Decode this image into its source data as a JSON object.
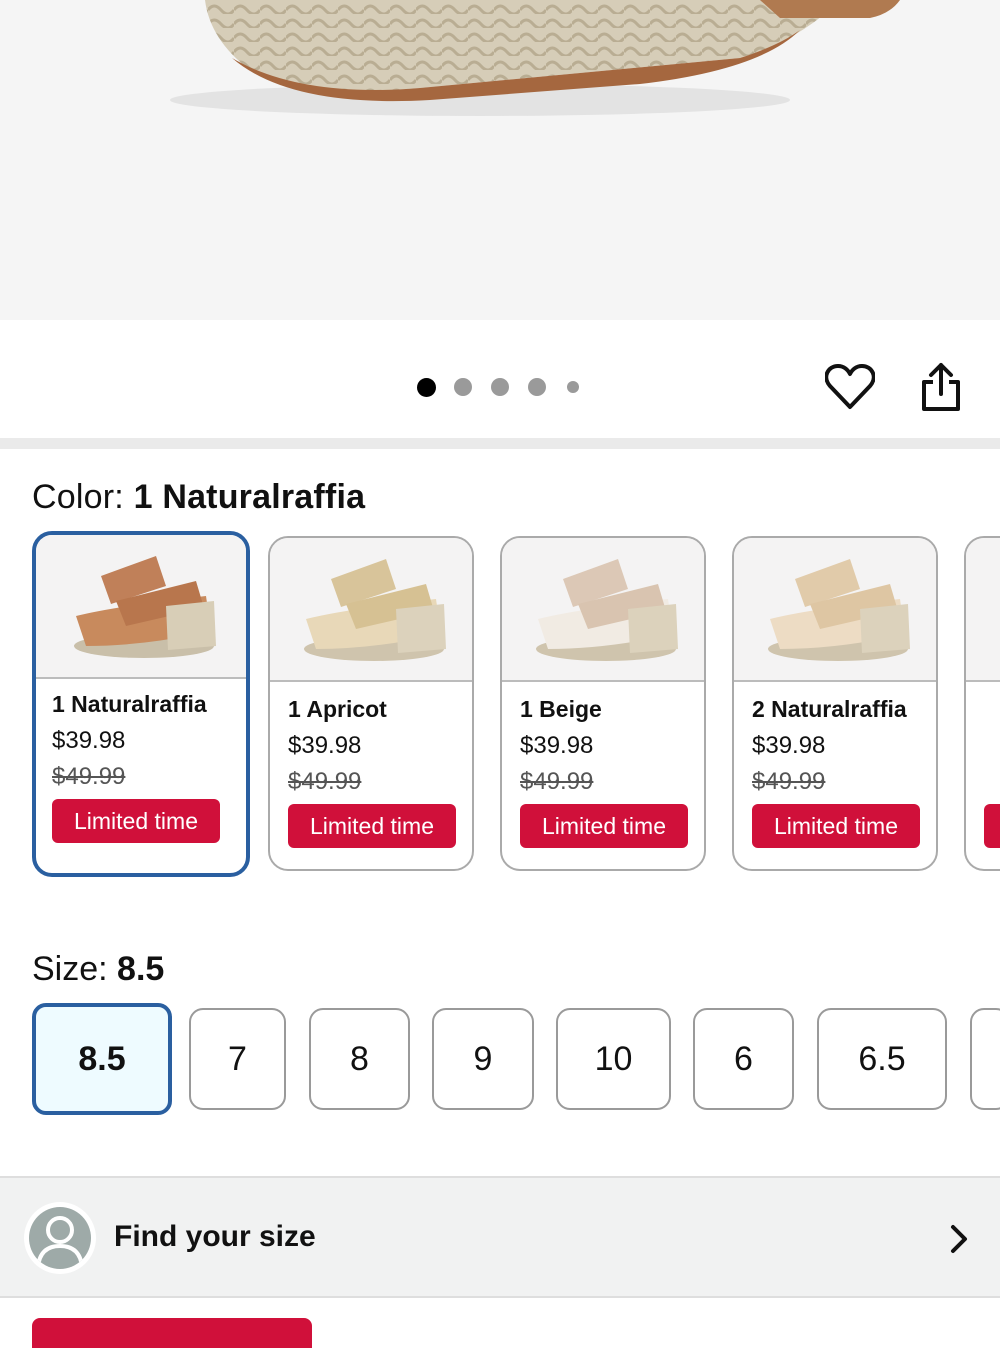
{
  "colors": {
    "accent_red": "#d0103a",
    "selected_blue": "#2a5fa0"
  },
  "carousel": {
    "dot_count": 5,
    "active_index": 0
  },
  "actions": {
    "favorite_icon": "heart-icon",
    "share_icon": "share-icon"
  },
  "color_section": {
    "prefix": "Color:",
    "selected": "1 Naturalraffia",
    "options": [
      {
        "name": "1 Naturalraffia",
        "price": "$39.98",
        "was": "$49.99",
        "badge": "Limited time"
      },
      {
        "name": "1 Apricot",
        "price": "$39.98",
        "was": "$49.99",
        "badge": "Limited time"
      },
      {
        "name": "1 Beige",
        "price": "$39.98",
        "was": "$49.99",
        "badge": "Limited time"
      },
      {
        "name": "2 Naturalraffia",
        "price": "$39.98",
        "was": "$49.99",
        "badge": "Limited time"
      }
    ]
  },
  "size_section": {
    "prefix": "Size:",
    "selected": "8.5",
    "options": [
      "8.5",
      "7",
      "8",
      "9",
      "10",
      "6",
      "6.5"
    ]
  },
  "find_size": {
    "label": "Find your size"
  }
}
